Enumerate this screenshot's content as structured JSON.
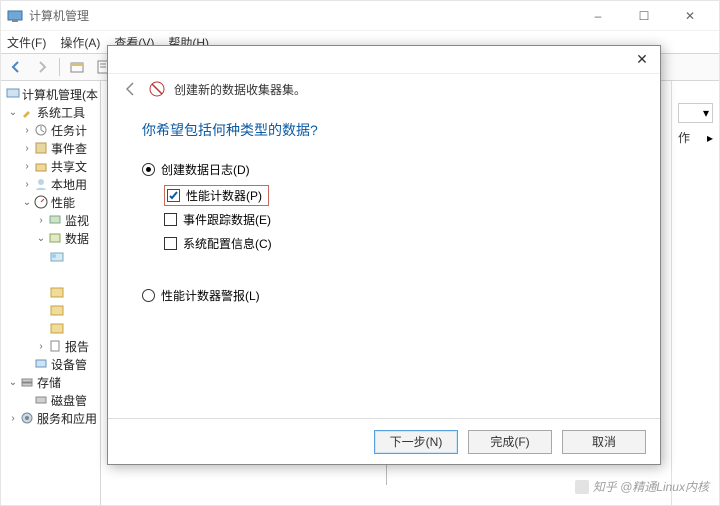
{
  "window": {
    "title": "计算机管理",
    "sysbuttons": {
      "min": "–",
      "max": "☐",
      "close": "✕"
    }
  },
  "menubar": [
    "文件(F)",
    "操作(A)",
    "查看(V)",
    "帮助(H)"
  ],
  "tree": {
    "root": "计算机管理(本",
    "sys_tools": "系统工具",
    "task": "任务计",
    "event": "事件查",
    "share": "共享文",
    "localuser": "本地用",
    "perf": "性能",
    "mon": "监视",
    "data": "数据",
    "report": "报告",
    "devmgr": "设备管",
    "storage": "存储",
    "disk": "磁盘管",
    "svc": "服务和应用"
  },
  "sidepanel": {
    "label": "作",
    "arrow": "▸",
    "dropdown": "▾"
  },
  "dialog": {
    "head": "创建新的数据收集器集。",
    "question": "你希望包括何种类型的数据?",
    "opt_log": "创建数据日志(D)",
    "sub_perf": "性能计数器(P)",
    "sub_trace": "事件跟踪数据(E)",
    "sub_sys": "系统配置信息(C)",
    "opt_alert": "性能计数器警报(L)",
    "btn_next": "下一步(N)",
    "btn_finish": "完成(F)",
    "btn_cancel": "取消"
  },
  "watermark": "知乎 @精通Linux内核"
}
